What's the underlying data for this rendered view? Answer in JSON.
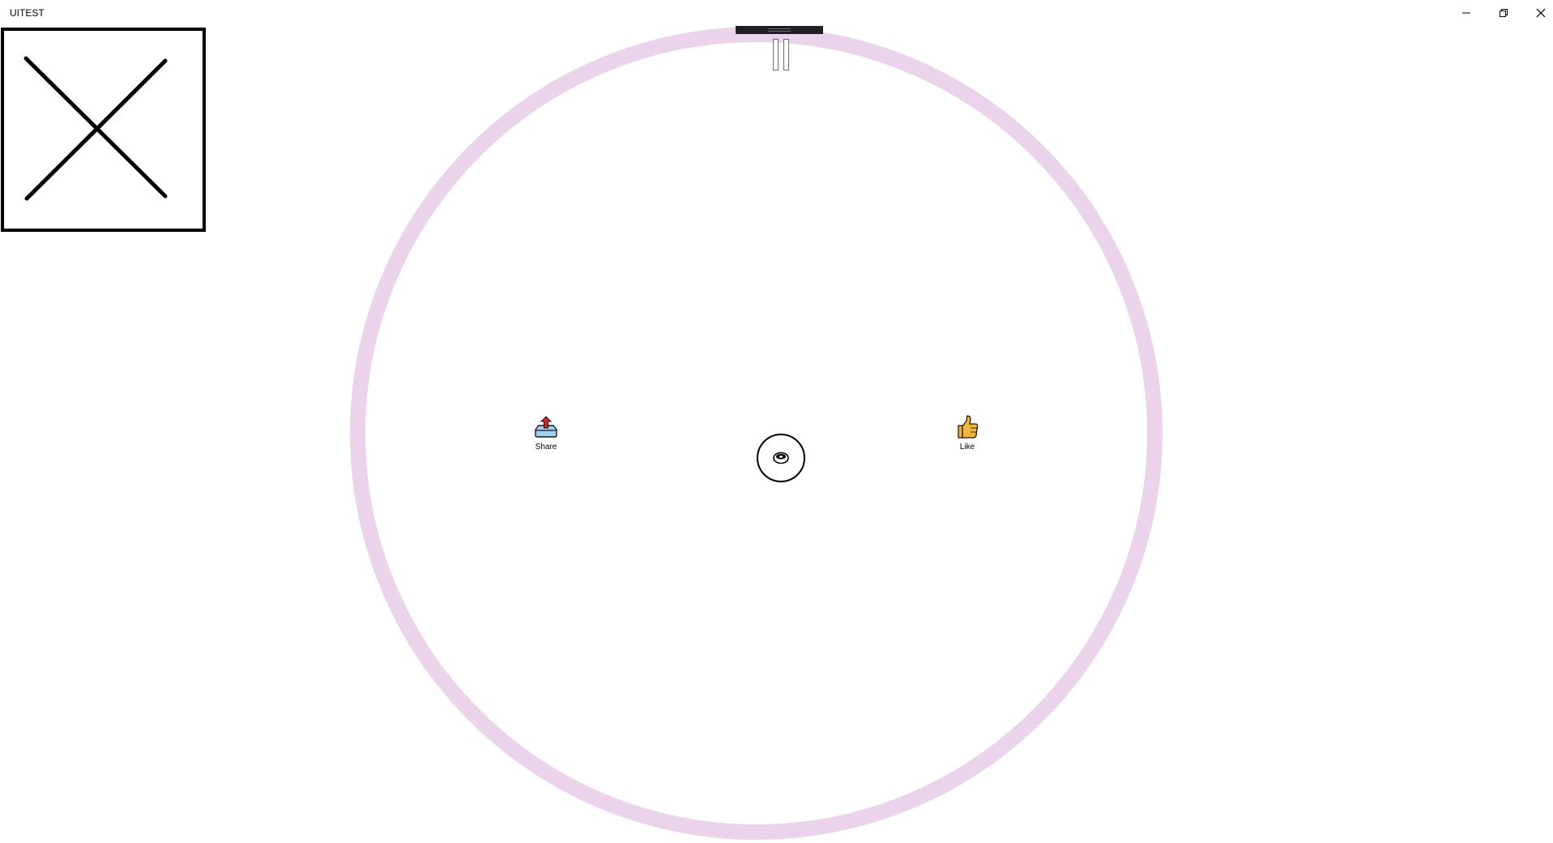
{
  "window": {
    "title": "UITEST",
    "controls": {
      "minimize_icon": "minimize-icon",
      "maximize_icon": "restore-icon",
      "close_icon": "close-icon"
    }
  },
  "colors": {
    "ring": "#ebd3eb",
    "handle": "#1e1e24",
    "share_tray": "#9fd0ef",
    "share_arrow": "#e02020",
    "like_thumb": "#f4b63a"
  },
  "wheel": {
    "top_handle_icon": "drag-handle-icon",
    "pause_icon": "pause-icon",
    "center_icon": "eye-icon",
    "actions": [
      {
        "label": "Share",
        "icon": "share-icon"
      },
      {
        "label": "Like",
        "icon": "thumbs-up-icon"
      }
    ]
  },
  "image_placeholder": {
    "icon": "x-placeholder-icon"
  }
}
